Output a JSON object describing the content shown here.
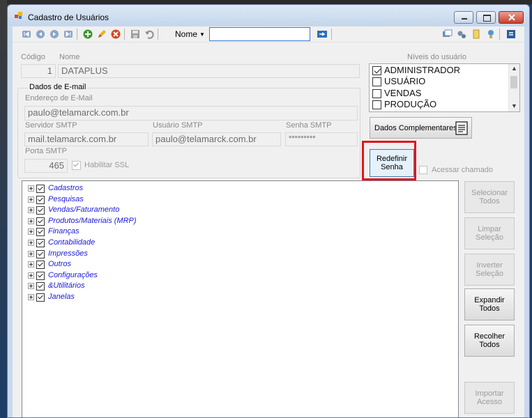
{
  "window": {
    "title": "Cadastro de Usuários"
  },
  "toolbar": {
    "search_field_label": "Nome",
    "search_value": ""
  },
  "form": {
    "codigo_label": "Código",
    "codigo_value": "1",
    "nome_label": "Nome",
    "nome_value": "DATAPLUS",
    "niveis_label": "Níveis do usuário",
    "email_group_title": "Dados de E-mail",
    "email_label": "Endereço de E-Mail",
    "email_value": "paulo@telamarck.com.br",
    "smtp_server_label": "Servidor SMTP",
    "smtp_server_value": "mail.telamarck.com.br",
    "smtp_user_label": "Usuário SMTP",
    "smtp_user_value": "paulo@telamarck.com.br",
    "smtp_password_label": "Senha SMTP",
    "smtp_password_value": "*********",
    "smtp_port_label": "Porta SMTP",
    "smtp_port_value": "465",
    "ssl_label": "Habilitar SSL",
    "ssl_checked": true
  },
  "levels": [
    {
      "label": "ADMINISTRADOR",
      "checked": true
    },
    {
      "label": "USUÁRIO",
      "checked": false
    },
    {
      "label": "VENDAS",
      "checked": false
    },
    {
      "label": "PRODUÇÃO",
      "checked": false
    }
  ],
  "buttons": {
    "dados_complementares": "Dados Complementares",
    "redefinir_senha_line1": "Redefinir",
    "redefinir_senha_line2": "Senha",
    "acessar_chamado": "Acessar chamado",
    "selecionar_todos_1": "Selecionar",
    "selecionar_todos_2": "Todos",
    "limpar_selecao_1": "Limpar",
    "limpar_selecao_2": "Seleção",
    "inverter_selecao_1": "Inverter",
    "inverter_selecao_2": "Seleção",
    "expandir_todos_1": "Expandir",
    "expandir_todos_2": "Todos",
    "recolher_todos_1": "Recolher",
    "recolher_todos_2": "Todos",
    "importar_acesso_1": "Importar",
    "importar_acesso_2": "Acesso"
  },
  "permissions_tree": [
    "Cadastros",
    "Pesquisas",
    "Vendas/Faturamento",
    "Produtos/Materiais (MRP)",
    "Finanças",
    "Contabilidade",
    "Impressões",
    "Outros",
    "Configurações",
    "&Utilitários",
    "Janelas"
  ],
  "colors": {
    "highlight": "#e0161b",
    "tree_text": "#1a1ad6"
  }
}
